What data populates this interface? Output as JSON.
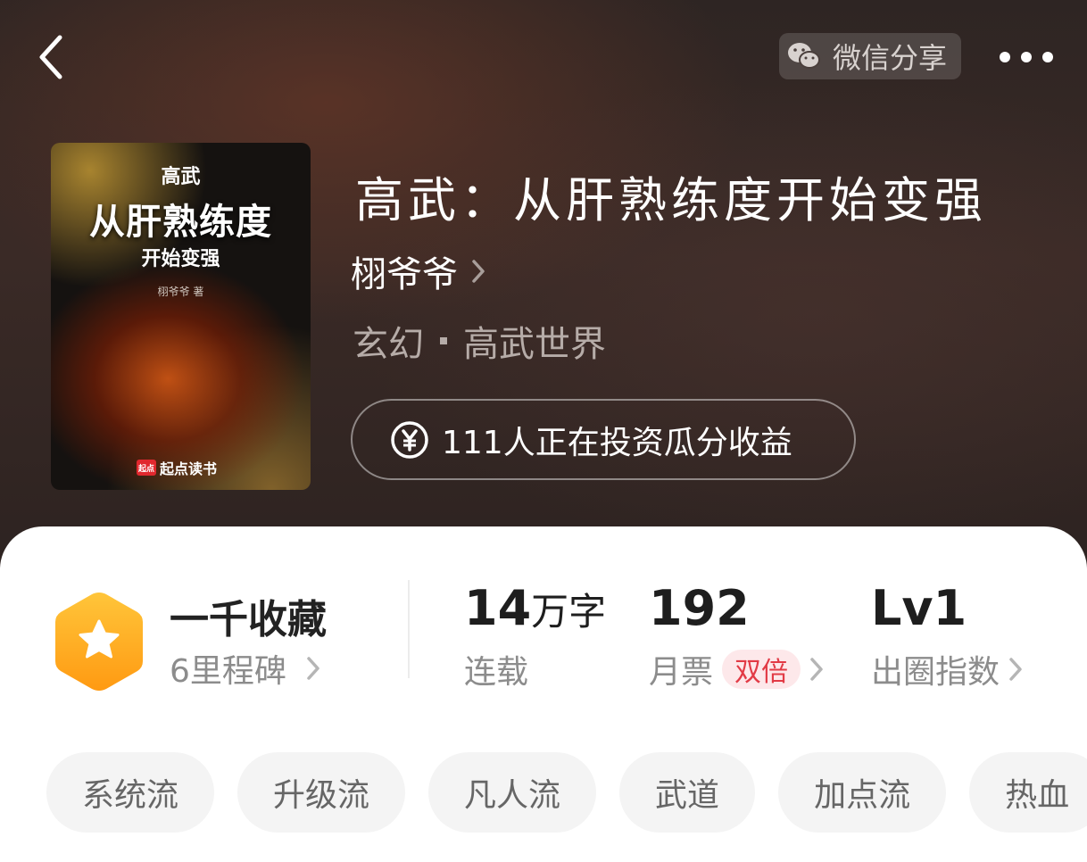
{
  "header": {
    "back_icon": "chevron-left-icon",
    "share": {
      "icon": "wechat-icon",
      "label": "微信分享"
    },
    "more_icon": "more-dots-icon"
  },
  "book": {
    "title": "高武：从肝熟练度开始变强",
    "author": "栩爷爷",
    "genre": "玄幻",
    "subgenre": "高武世界",
    "cover": {
      "small_title": "高武",
      "big_title": "从肝熟练度",
      "sub_title": "开始变强",
      "author_line": "栩爷爷 著",
      "publisher": "起点读书",
      "publisher_logo": "起点"
    },
    "invest": {
      "icon": "yuan-coin-icon",
      "label": "111人正在投资瓜分收益"
    }
  },
  "stats": {
    "milestone": {
      "title": "一千收藏",
      "subtitle": "6里程碑"
    },
    "words": {
      "value": "14",
      "unit": "万字",
      "label": "连载"
    },
    "monthly_ticket": {
      "value": "192",
      "label": "月票",
      "badge": "双倍"
    },
    "influence": {
      "value": "Lv1",
      "label": "出圈指数"
    }
  },
  "tags": [
    "系统流",
    "升级流",
    "凡人流",
    "武道",
    "加点流",
    "热血"
  ],
  "colors": {
    "accent_red": "#e23b46",
    "milestone_orange": "#ffa316",
    "hero_bg": "#2e2523"
  }
}
